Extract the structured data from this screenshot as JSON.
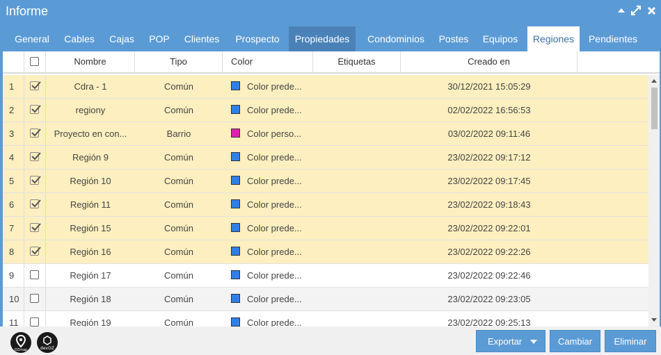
{
  "window": {
    "title": "Informe",
    "accent_color": "#5b9bd5",
    "controls": [
      "collapse-icon",
      "maximize-icon",
      "close-icon"
    ]
  },
  "tabs": [
    {
      "label": "General"
    },
    {
      "label": "Cables"
    },
    {
      "label": "Cajas"
    },
    {
      "label": "POP"
    },
    {
      "label": "Clientes"
    },
    {
      "label": "Prospecto"
    },
    {
      "label": "Propiedades",
      "state": "hover"
    },
    {
      "label": "Condominios"
    },
    {
      "label": "Postes"
    },
    {
      "label": "Equipos"
    },
    {
      "label": "Regiones",
      "state": "active"
    },
    {
      "label": "Pendientes"
    }
  ],
  "table": {
    "columns": [
      "Nombre",
      "Tipo",
      "Color",
      "Etiquetas",
      "Creado en"
    ],
    "rows": [
      {
        "index": "1",
        "checked": true,
        "name": "Cdra - 1",
        "tipo": "Común",
        "color_label": "Color prede...",
        "color": "#2f7fea",
        "etiquetas": "",
        "creado": "30/12/2021 15:05:29"
      },
      {
        "index": "2",
        "checked": true,
        "name": "regiony",
        "tipo": "Común",
        "color_label": "Color prede...",
        "color": "#2f7fea",
        "etiquetas": "",
        "creado": "02/02/2022 16:56:53"
      },
      {
        "index": "3",
        "checked": true,
        "name": "Proyecto en con...",
        "tipo": "Barrio",
        "color_label": "Color perso...",
        "color": "#e01fb0",
        "etiquetas": "",
        "creado": "03/02/2022 09:11:46"
      },
      {
        "index": "4",
        "checked": true,
        "name": "Región 9",
        "tipo": "Común",
        "color_label": "Color prede...",
        "color": "#2f7fea",
        "etiquetas": "",
        "creado": "23/02/2022 09:17:12"
      },
      {
        "index": "5",
        "checked": true,
        "name": "Región 10",
        "tipo": "Común",
        "color_label": "Color prede...",
        "color": "#2f7fea",
        "etiquetas": "",
        "creado": "23/02/2022 09:17:45"
      },
      {
        "index": "6",
        "checked": true,
        "name": "Región 11",
        "tipo": "Común",
        "color_label": "Color prede...",
        "color": "#2f7fea",
        "etiquetas": "",
        "creado": "23/02/2022 09:18:43"
      },
      {
        "index": "7",
        "checked": true,
        "name": "Región 15",
        "tipo": "Común",
        "color_label": "Color prede...",
        "color": "#2f7fea",
        "etiquetas": "",
        "creado": "23/02/2022 09:22:01"
      },
      {
        "index": "8",
        "checked": true,
        "name": "Región 16",
        "tipo": "Común",
        "color_label": "Color prede...",
        "color": "#2f7fea",
        "etiquetas": "",
        "creado": "23/02/2022 09:22:26"
      },
      {
        "index": "9",
        "checked": false,
        "name": "Región 17",
        "tipo": "Común",
        "color_label": "Color prede...",
        "color": "#2f7fea",
        "etiquetas": "",
        "creado": "23/02/2022 09:22:46"
      },
      {
        "index": "10",
        "checked": false,
        "name": "Región 18",
        "tipo": "Común",
        "color_label": "Color prede...",
        "color": "#2f7fea",
        "etiquetas": "",
        "creado": "23/02/2022 09:23:05"
      },
      {
        "index": "11",
        "checked": false,
        "name": "Región 19",
        "tipo": "Común",
        "color_label": "Color prede...",
        "color": "#2f7fea",
        "etiquetas": "",
        "creado": "23/02/2022 09:25:13"
      }
    ]
  },
  "footer": {
    "logos": [
      {
        "icon": "ozmap-logo-icon",
        "text": "OZmap"
      },
      {
        "icon": "devoz-logo-icon",
        "text": "devOZ"
      }
    ],
    "buttons": [
      {
        "label": "Exportar",
        "dropdown": true
      },
      {
        "label": "Cambiar"
      },
      {
        "label": "Eliminar"
      }
    ]
  }
}
